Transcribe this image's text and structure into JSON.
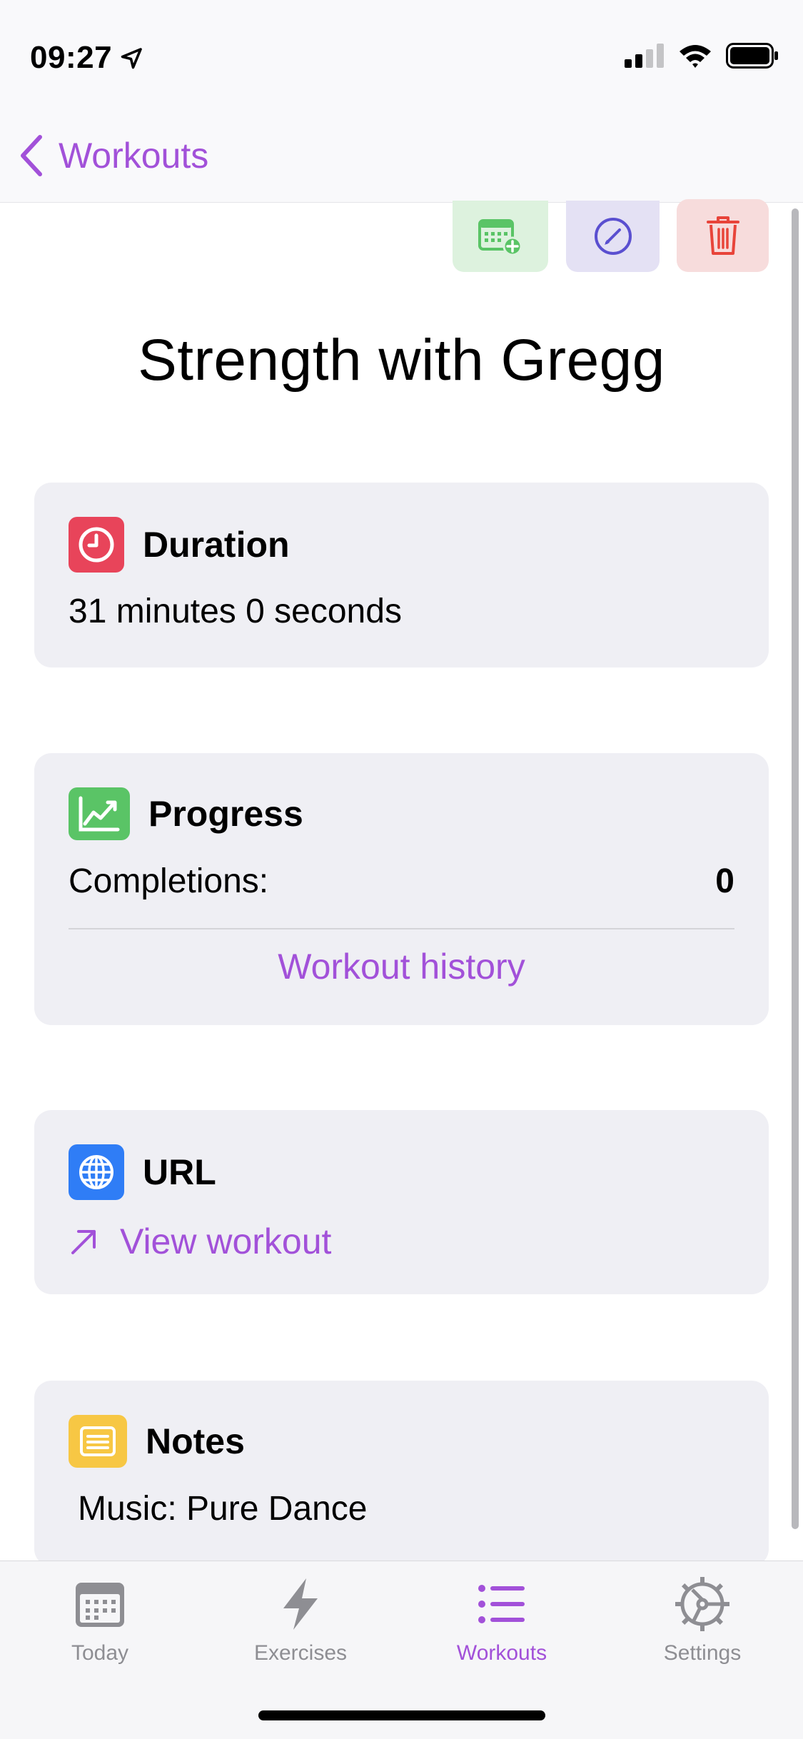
{
  "status_bar": {
    "time": "09:27"
  },
  "nav": {
    "back_label": "Workouts"
  },
  "workout": {
    "title": "Strength with Gregg",
    "duration": {
      "title": "Duration",
      "value": "31 minutes  0 seconds"
    },
    "progress": {
      "title": "Progress",
      "completions_label": "Completions:",
      "completions_value": "0",
      "history_link": "Workout history"
    },
    "url": {
      "title": "URL",
      "link_label": "View workout"
    },
    "notes": {
      "title": "Notes",
      "text": "Music: Pure Dance"
    }
  },
  "tabs": [
    {
      "label": "Today",
      "icon": "calendar-icon"
    },
    {
      "label": "Exercises",
      "icon": "lightning-icon"
    },
    {
      "label": "Workouts",
      "icon": "list-icon",
      "active": true
    },
    {
      "label": "Settings",
      "icon": "gear-icon"
    }
  ],
  "colors": {
    "accent": "#a251d9",
    "duration_icon": "#e8445a",
    "progress_icon": "#5ac466",
    "url_icon": "#2f7df6",
    "notes_icon": "#f7c744"
  }
}
